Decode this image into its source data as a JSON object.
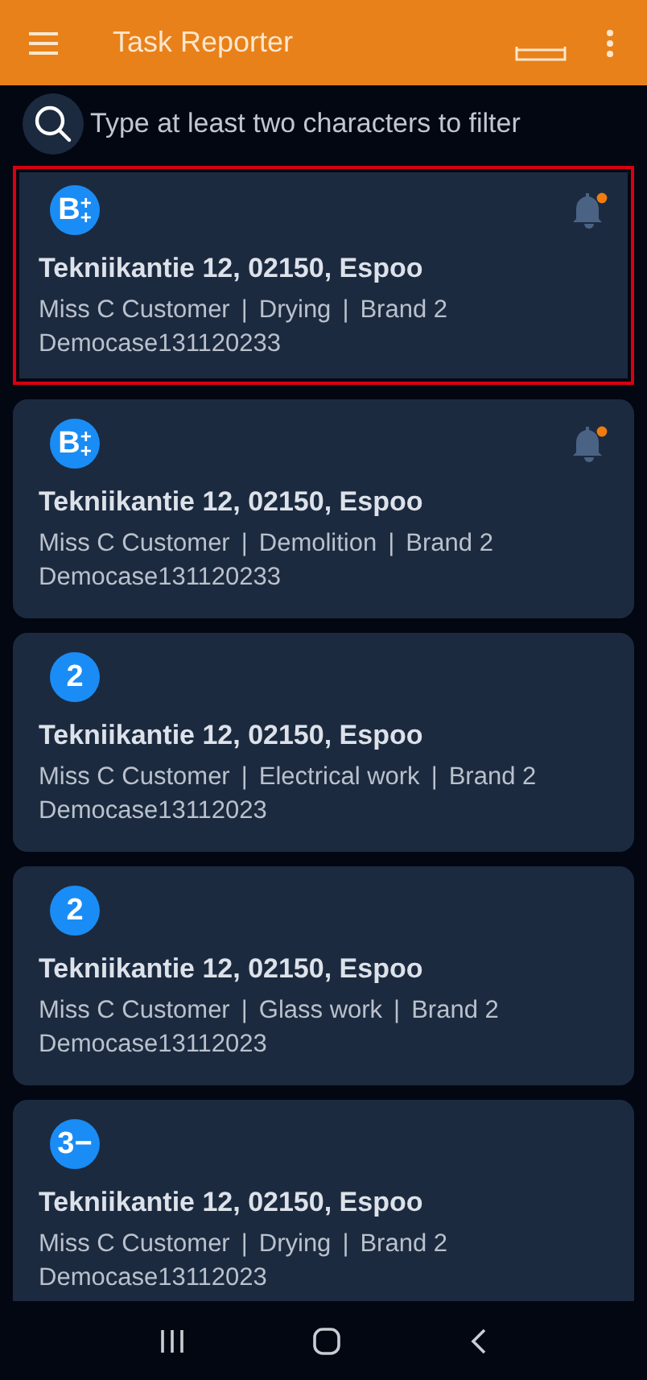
{
  "app_bar": {
    "title": "Task Reporter"
  },
  "search": {
    "placeholder": "Type at least two characters to filter"
  },
  "tasks": [
    {
      "badge": "B",
      "badge_stack": [
        "+",
        "+"
      ],
      "notification": true,
      "selected": true,
      "address": "Tekniikantie 12, 02150, Espoo",
      "customer": "Miss C Customer",
      "separator": "|",
      "work": "Drying",
      "brand": "Brand 2",
      "case": "Democase131120233"
    },
    {
      "badge": "B",
      "badge_stack": [
        "+",
        "+"
      ],
      "notification": true,
      "selected": false,
      "address": "Tekniikantie 12, 02150, Espoo",
      "customer": "Miss C Customer",
      "separator": "|",
      "work": "Demolition",
      "brand": "Brand 2",
      "case": "Democase131120233"
    },
    {
      "badge": "2",
      "notification": false,
      "selected": false,
      "address": "Tekniikantie 12, 02150, Espoo",
      "customer": "Miss C Customer",
      "separator": "|",
      "work": "Electrical work",
      "brand": "Brand 2",
      "case": "Democase13112023"
    },
    {
      "badge": "2",
      "notification": false,
      "selected": false,
      "address": "Tekniikantie 12, 02150, Espoo",
      "customer": "Miss C Customer",
      "separator": "|",
      "work": "Glass work",
      "brand": "Brand 2",
      "case": "Democase13112023"
    },
    {
      "badge": "3−",
      "notification": false,
      "selected": false,
      "address": "Tekniikantie 12, 02150, Espoo",
      "customer": "Miss C Customer",
      "separator": "|",
      "work": "Drying",
      "brand": "Brand 2",
      "case": "Democase13112023"
    }
  ]
}
